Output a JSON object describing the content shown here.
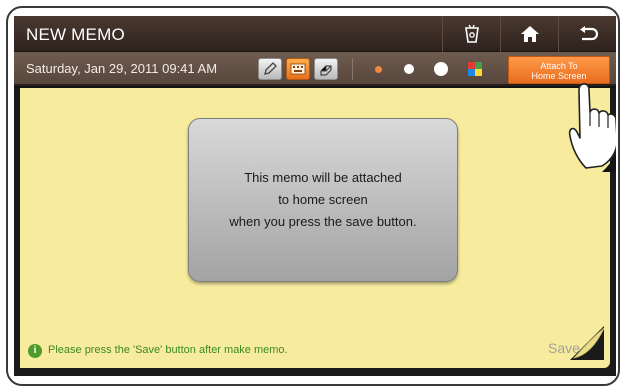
{
  "titlebar": {
    "title": "NEW MEMO",
    "buttons": [
      {
        "name": "memo-cup-icon"
      },
      {
        "name": "home-icon"
      },
      {
        "name": "back-icon"
      }
    ]
  },
  "toolbar": {
    "date": "Saturday, Jan 29, 2011 09:41 AM",
    "tools": [
      {
        "name": "pen-tool-icon",
        "selected": false
      },
      {
        "name": "keyboard-tool-icon",
        "selected": true
      },
      {
        "name": "eraser-tool-icon",
        "selected": false
      }
    ],
    "pen_sizes": [
      {
        "name": "pen-size-small",
        "color": "#f08a3a"
      },
      {
        "name": "pen-size-medium",
        "color": "#ffffff"
      },
      {
        "name": "pen-size-large",
        "color": "#ffffff"
      }
    ],
    "palette_icon": "color-palette-icon",
    "attach_label_line1": "Attach To",
    "attach_label_line2": "Home Screen"
  },
  "popup": {
    "line1": "This memo will be attached",
    "line2": "to home screen",
    "line3": "when you press the save button."
  },
  "footer": {
    "message": "Please press the 'Save' button after make memo.",
    "save_label": "Save"
  },
  "colors": {
    "paper": "#f7ec9e",
    "accent_orange": "#e86d1d",
    "info_green": "#4e9b2a"
  }
}
